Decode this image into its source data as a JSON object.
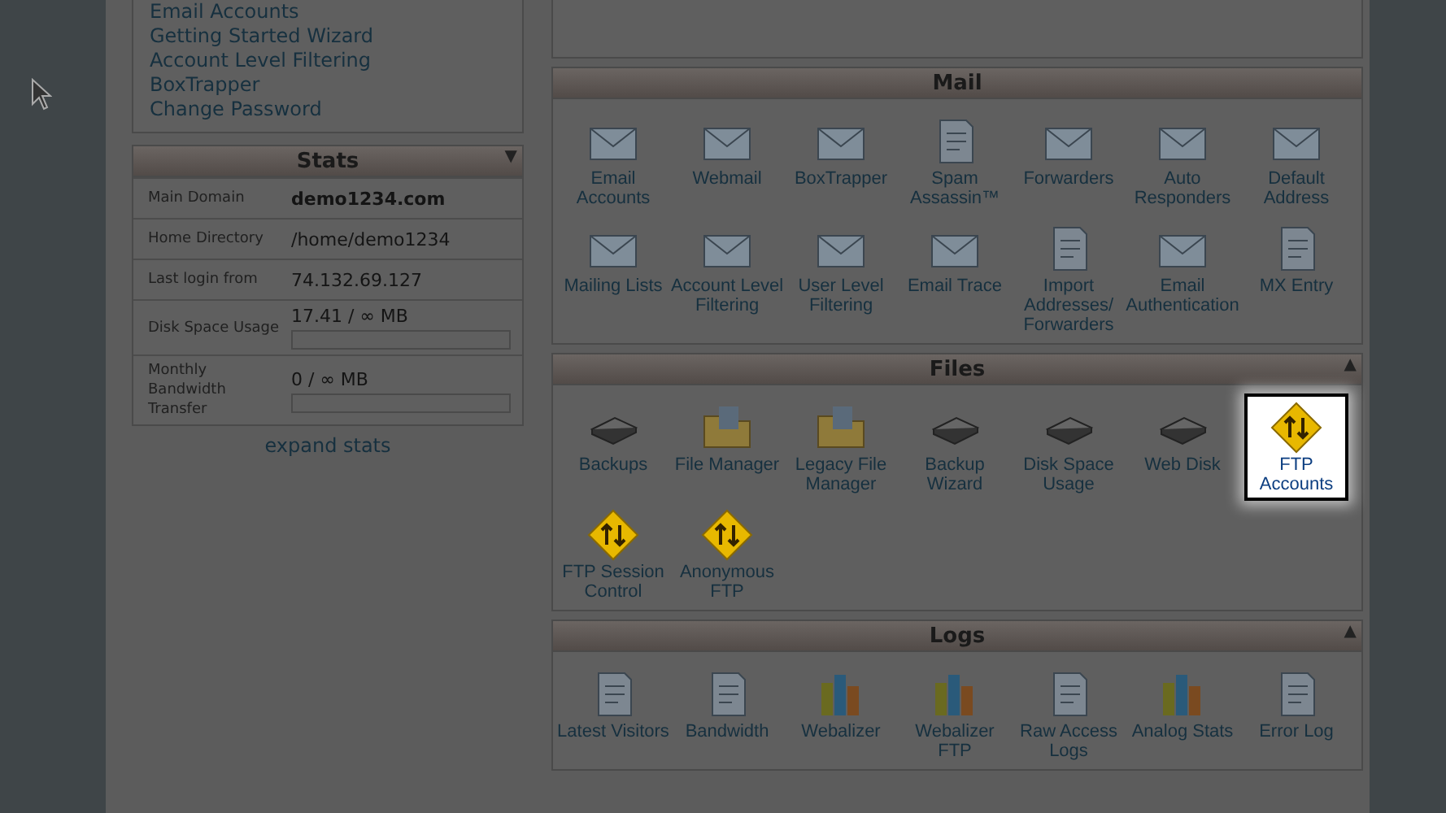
{
  "sidebar": {
    "links": [
      {
        "label": "Email Accounts"
      },
      {
        "label": "Getting Started Wizard"
      },
      {
        "label": "Account Level Filtering"
      },
      {
        "label": "BoxTrapper"
      },
      {
        "label": "Change Password"
      }
    ],
    "stats": {
      "title": "Stats",
      "toggle": "▼",
      "rows": [
        {
          "label": "Main Domain",
          "value": "demo1234.com",
          "kind": "bold"
        },
        {
          "label": "Home Directory",
          "value": "/home/demo1234",
          "kind": "text"
        },
        {
          "label": "Last login from",
          "value": "74.132.69.127",
          "kind": "text"
        },
        {
          "label": "Disk Space Usage",
          "value": "17.41 / ∞ MB",
          "kind": "meter",
          "level": 0
        },
        {
          "label": "Monthly Bandwidth Transfer",
          "value": "0 / ∞ MB",
          "kind": "meter",
          "level": 0
        }
      ],
      "expand": "expand stats"
    }
  },
  "sections": [
    {
      "title": "Mail",
      "items": [
        {
          "label": "Email Accounts",
          "highlighted": false
        },
        {
          "label": "Webmail",
          "highlighted": false
        },
        {
          "label": "BoxTrapper",
          "highlighted": false
        },
        {
          "label": "Spam Assassin™",
          "highlighted": false
        },
        {
          "label": "Forwarders",
          "highlighted": false
        },
        {
          "label": "Auto Responders",
          "highlighted": false
        },
        {
          "label": "Default Address",
          "highlighted": false
        },
        {
          "label": "Mailing Lists",
          "highlighted": false
        },
        {
          "label": "Account Level Filtering",
          "highlighted": false
        },
        {
          "label": "User Level Filtering",
          "highlighted": false
        },
        {
          "label": "Email Trace",
          "highlighted": false
        },
        {
          "label": "Import Addresses/ Forwarders",
          "highlighted": false
        },
        {
          "label": "Email Authentication",
          "highlighted": false
        },
        {
          "label": "MX Entry",
          "highlighted": false
        }
      ]
    },
    {
      "title": "Files",
      "toggle": "▲",
      "items": [
        {
          "label": "Backups",
          "highlighted": false
        },
        {
          "label": "File Manager",
          "highlighted": false
        },
        {
          "label": "Legacy File Manager",
          "highlighted": false
        },
        {
          "label": "Backup Wizard",
          "highlighted": false
        },
        {
          "label": "Disk Space Usage",
          "highlighted": false
        },
        {
          "label": "Web Disk",
          "highlighted": false
        },
        {
          "label": "FTP Accounts",
          "highlighted": true
        },
        {
          "label": "FTP Session Control",
          "highlighted": false
        },
        {
          "label": "Anonymous FTP",
          "highlighted": false
        }
      ]
    },
    {
      "title": "Logs",
      "toggle": "▲",
      "items": [
        {
          "label": "Latest Visitors",
          "highlighted": false
        },
        {
          "label": "Bandwidth",
          "highlighted": false
        },
        {
          "label": "Webalizer",
          "highlighted": false
        },
        {
          "label": "Webalizer FTP",
          "highlighted": false
        },
        {
          "label": "Raw Access Logs",
          "highlighted": false
        },
        {
          "label": "Analog Stats",
          "highlighted": false
        },
        {
          "label": "Error Log",
          "highlighted": false
        }
      ]
    }
  ]
}
